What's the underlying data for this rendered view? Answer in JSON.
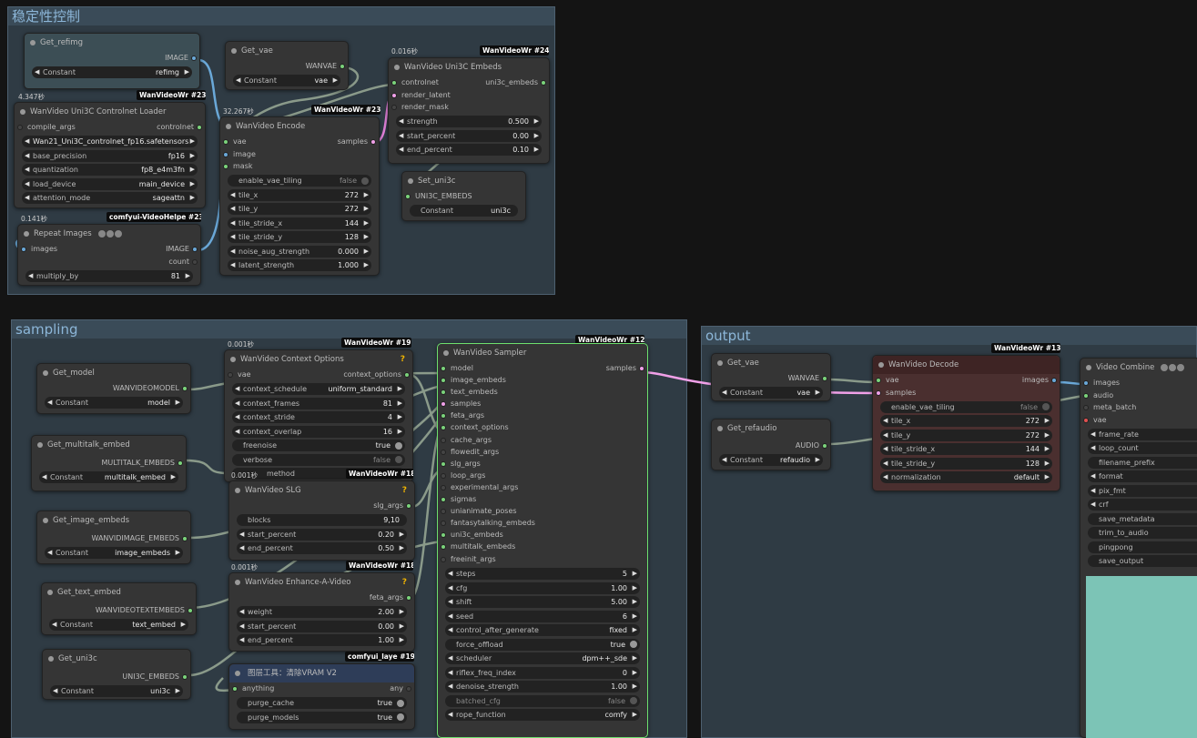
{
  "groups": {
    "stability": "稳定性控制",
    "sampling": "sampling",
    "output": "output"
  },
  "colors": {
    "canvas": "#141414",
    "group": "#2f3b44",
    "node": "#353535",
    "accent_green": "#7bd37b",
    "link_pink": "#f0a0e8"
  },
  "common": {
    "constant": "Constant"
  },
  "n_get_refimg": {
    "title": "Get_refimg",
    "output": "IMAGE",
    "value": "refimg"
  },
  "n_get_vae_top": {
    "title": "Get_vae",
    "output": "WANVAE",
    "value": "vae"
  },
  "n_uni3c_embeds": {
    "title": "WanVideo Uni3C Embeds",
    "badge": "WanVideoWr",
    "id": "#240",
    "time": "0.016秒",
    "inputs": [
      "controlnet",
      "render_latent",
      "render_mask"
    ],
    "output": "uni3c_embeds",
    "widgets": [
      {
        "label": "strength",
        "value": "0.500"
      },
      {
        "label": "start_percent",
        "value": "0.00"
      },
      {
        "label": "end_percent",
        "value": "0.10"
      }
    ]
  },
  "n_controlnet_loader": {
    "title": "WanVideo Uni3C Controlnet Loader",
    "badge": "WanVideoWr",
    "id": "#239",
    "time": "4.347秒",
    "input": "compile_args",
    "output": "controlnet",
    "model": "Wan21_Uni3C_controlnet_fp16.safetensors",
    "widgets": [
      {
        "label": "base_precision",
        "value": "fp16"
      },
      {
        "label": "quantization",
        "value": "fp8_e4m3fn"
      },
      {
        "label": "load_device",
        "value": "main_device"
      },
      {
        "label": "attention_mode",
        "value": "sageattn"
      }
    ]
  },
  "n_encode": {
    "title": "WanVideo Encode",
    "badge": "WanVideoWr",
    "id": "#238",
    "time": "32.267秒",
    "inputs": [
      "vae",
      "image",
      "mask"
    ],
    "output": "samples",
    "toggle": {
      "label": "enable_vae_tiling",
      "value": "false"
    },
    "widgets": [
      {
        "label": "tile_x",
        "value": "272"
      },
      {
        "label": "tile_y",
        "value": "272"
      },
      {
        "label": "tile_stride_x",
        "value": "144"
      },
      {
        "label": "tile_stride_y",
        "value": "128"
      },
      {
        "label": "noise_aug_strength",
        "value": "0.000"
      },
      {
        "label": "latent_strength",
        "value": "1.000"
      }
    ]
  },
  "n_set_uni3c": {
    "title": "Set_uni3c",
    "input": "UNI3C_EMBEDS",
    "value": "uni3c"
  },
  "n_repeat": {
    "title": "Repeat Images",
    "badge": "comfyui-VideoHelpe",
    "id": "#237",
    "time": "0.141秒",
    "input": "images",
    "outputs": [
      "IMAGE",
      "count"
    ],
    "widget": {
      "label": "multiply_by",
      "value": "81"
    }
  },
  "n_get_model": {
    "title": "Get_model",
    "output": "WANVIDEOMODEL",
    "value": "model"
  },
  "n_get_multitalk": {
    "title": "Get_multitalk_embed",
    "output": "MULTITALK_EMBEDS",
    "value": "multitalk_embed"
  },
  "n_get_image_embeds": {
    "title": "Get_image_embeds",
    "output": "WANVIDIMAGE_EMBEDS",
    "value": "image_embeds"
  },
  "n_get_text_embed": {
    "title": "Get_text_embed",
    "output": "WANVIDEOTEXTEMBEDS",
    "value": "text_embed"
  },
  "n_get_uni3c": {
    "title": "Get_uni3c",
    "output": "UNI3C_EMBEDS",
    "value": "uni3c"
  },
  "n_context": {
    "title": "WanVideo Context Options",
    "badge": "WanVideoWr",
    "id": "#191",
    "time": "0.001秒",
    "q": "?",
    "input": "vae",
    "output": "context_options",
    "widgets": [
      {
        "label": "context_schedule",
        "value": "uniform_standard"
      },
      {
        "label": "context_frames",
        "value": "81"
      },
      {
        "label": "context_stride",
        "value": "4"
      },
      {
        "label": "context_overlap",
        "value": "16"
      }
    ],
    "toggles": [
      {
        "label": "freenoise",
        "value": "true"
      },
      {
        "label": "verbose",
        "value": "false"
      }
    ],
    "hidden_label": "method"
  },
  "n_slg": {
    "title": "WanVideo SLG",
    "badge": "WanVideoWr",
    "id": "#189",
    "time": "0.001秒",
    "q": "?",
    "output": "slg_args",
    "blocks": {
      "label": "blocks",
      "value": "9,10"
    },
    "widgets": [
      {
        "label": "start_percent",
        "value": "0.20"
      },
      {
        "label": "end_percent",
        "value": "0.50"
      }
    ]
  },
  "n_enhance": {
    "title": "WanVideo Enhance-A-Video",
    "badge": "WanVideoWr",
    "id": "#188",
    "time": "0.001秒",
    "q": "?",
    "output": "feta_args",
    "widgets": [
      {
        "label": "weight",
        "value": "2.00"
      },
      {
        "label": "start_percent",
        "value": "0.00"
      },
      {
        "label": "end_percent",
        "value": "1.00"
      }
    ]
  },
  "n_vram": {
    "title": "图层工具：清除VRAM V2",
    "badge": "comfyui_laye",
    "id": "#190",
    "input": "anything",
    "output": "any",
    "toggles": [
      {
        "label": "purge_cache",
        "value": "true"
      },
      {
        "label": "purge_models",
        "value": "true"
      }
    ]
  },
  "n_sampler": {
    "title": "WanVideo Sampler",
    "badge": "WanVideoWr",
    "id": "#128",
    "output": "samples",
    "inputs": [
      "model",
      "image_embeds",
      "text_embeds",
      "samples",
      "feta_args",
      "context_options",
      "cache_args",
      "flowedit_args",
      "slg_args",
      "loop_args",
      "experimental_args",
      "sigmas",
      "unianimate_poses",
      "fantasytalking_embeds",
      "uni3c_embeds",
      "multitalk_embeds",
      "freeinit_args"
    ],
    "widgets": [
      {
        "label": "steps",
        "value": "5"
      },
      {
        "label": "cfg",
        "value": "1.00"
      },
      {
        "label": "shift",
        "value": "5.00"
      },
      {
        "label": "seed",
        "value": "6"
      },
      {
        "label": "control_after_generate",
        "value": "fixed"
      }
    ],
    "force_offload": {
      "label": "force_offload",
      "value": "true"
    },
    "widgets2": [
      {
        "label": "scheduler",
        "value": "dpm++_sde"
      },
      {
        "label": "riflex_freq_index",
        "value": "0"
      },
      {
        "label": "denoise_strength",
        "value": "1.00"
      }
    ],
    "batched_cfg": {
      "label": "batched_cfg",
      "value": "false"
    },
    "rope": {
      "label": "rope_function",
      "value": "comfy"
    }
  },
  "n_get_vae_out": {
    "title": "Get_vae",
    "output": "WANVAE",
    "value": "vae"
  },
  "n_get_refaudio": {
    "title": "Get_refaudio",
    "output": "AUDIO",
    "value": "refaudio"
  },
  "n_decode": {
    "title": "WanVideo Decode",
    "badge": "WanVideoWr",
    "id": "#130",
    "inputs": [
      "vae",
      "samples"
    ],
    "output": "images",
    "toggle": {
      "label": "enable_vae_tiling",
      "value": "false"
    },
    "widgets": [
      {
        "label": "tile_x",
        "value": "272"
      },
      {
        "label": "tile_y",
        "value": "272"
      },
      {
        "label": "tile_stride_x",
        "value": "144"
      },
      {
        "label": "tile_stride_y",
        "value": "128"
      },
      {
        "label": "normalization",
        "value": "default"
      }
    ]
  },
  "n_combine": {
    "title": "Video Combine",
    "inputs": [
      "images",
      "audio",
      "meta_batch",
      "vae"
    ],
    "widgets": [
      "frame_rate",
      "loop_count",
      "filename_prefix",
      "format",
      "pix_fmt",
      "crf",
      "save_metadata",
      "trim_to_audio",
      "pingpong",
      "save_output"
    ]
  }
}
